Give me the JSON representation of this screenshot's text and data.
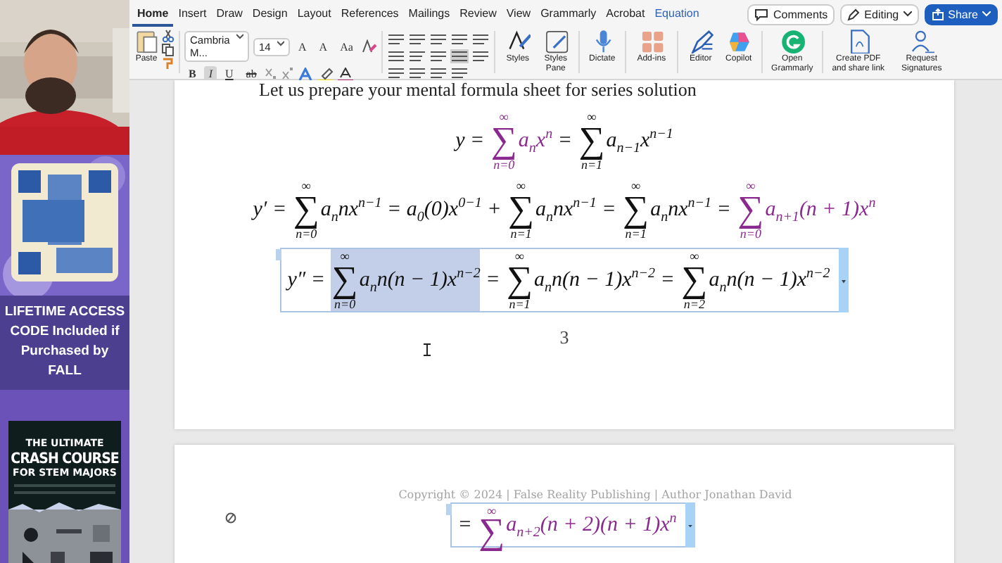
{
  "sidebar": {
    "promo_text": "LIFETIME ACCESS CODE Included if Purchased by FALL",
    "book": {
      "kicker": "THE ULTIMATE",
      "title": "CRASH COURSE",
      "subtitle": "FOR STEM MAJORS"
    }
  },
  "ribbon": {
    "tabs": [
      {
        "label": "Home",
        "selected": true,
        "contextual": false
      },
      {
        "label": "Insert",
        "selected": false,
        "contextual": false
      },
      {
        "label": "Draw",
        "selected": false,
        "contextual": false
      },
      {
        "label": "Design",
        "selected": false,
        "contextual": false
      },
      {
        "label": "Layout",
        "selected": false,
        "contextual": false
      },
      {
        "label": "References",
        "selected": false,
        "contextual": false
      },
      {
        "label": "Mailings",
        "selected": false,
        "contextual": false
      },
      {
        "label": "Review",
        "selected": false,
        "contextual": false
      },
      {
        "label": "View",
        "selected": false,
        "contextual": false
      },
      {
        "label": "Grammarly",
        "selected": false,
        "contextual": false
      },
      {
        "label": "Acrobat",
        "selected": false,
        "contextual": false
      },
      {
        "label": "Equation",
        "selected": false,
        "contextual": true
      }
    ],
    "comments": "Comments",
    "editing": "Editing",
    "share": "Share",
    "paste": "Paste",
    "font": "Cambria M...",
    "size": "14",
    "format_row1": [
      {
        "label": "A",
        "pressed": false
      },
      {
        "label": "A",
        "pressed": false
      },
      {
        "label": "Aa",
        "pressed": false
      }
    ],
    "format_row2": [
      {
        "label": "B",
        "pressed": false
      },
      {
        "label": "I",
        "pressed": true
      },
      {
        "label": "U",
        "pressed": false
      },
      {
        "label": "ab",
        "pressed": false
      }
    ],
    "tools": [
      "Styles",
      "Styles Pane",
      "Dictate",
      "Add-ins",
      "Editor",
      "Copilot",
      "Open Grammarly",
      "Create PDF and share link",
      "Request Signatures"
    ]
  },
  "document": {
    "intro": "Let us prepare your mental formula sheet for series solution",
    "equations": [
      {
        "boxed": false,
        "parts": [
          {
            "kind": "text",
            "text": "y = ",
            "emphasized": false,
            "selected": false
          },
          {
            "kind": "sum",
            "upper": "∞",
            "sign": "∑",
            "lower": "n=0",
            "emphasized": true,
            "selected": false
          },
          {
            "kind": "text",
            "text": "a$_{n}$x$^{n}$",
            "emphasized": true,
            "selected": false
          },
          {
            "kind": "text",
            "text": " = ",
            "emphasized": false,
            "selected": false
          },
          {
            "kind": "sum",
            "upper": "∞",
            "sign": "∑",
            "lower": "n=1",
            "emphasized": false,
            "selected": false
          },
          {
            "kind": "text",
            "text": "a$_{n−1}$x$^{n−1}$",
            "emphasized": false,
            "selected": false
          }
        ]
      },
      {
        "boxed": false,
        "parts": [
          {
            "kind": "text",
            "text": "y′ = ",
            "emphasized": false,
            "selected": false
          },
          {
            "kind": "sum",
            "upper": "∞",
            "sign": "∑",
            "lower": "n=0",
            "emphasized": false,
            "selected": false
          },
          {
            "kind": "text",
            "text": "a$_{n}$nx$^{n−1}$ = a$_{0}$(0)x$^{0−1}$ + ",
            "emphasized": false,
            "selected": false
          },
          {
            "kind": "sum",
            "upper": "∞",
            "sign": "∑",
            "lower": "n=1",
            "emphasized": false,
            "selected": false
          },
          {
            "kind": "text",
            "text": "a$_{n}$nx$^{n−1}$ = ",
            "emphasized": false,
            "selected": false
          },
          {
            "kind": "sum",
            "upper": "∞",
            "sign": "∑",
            "lower": "n=1",
            "emphasized": false,
            "selected": false
          },
          {
            "kind": "text",
            "text": "a$_{n}$nx$^{n−1}$ = ",
            "emphasized": false,
            "selected": false
          },
          {
            "kind": "sum",
            "upper": "∞",
            "sign": "∑",
            "lower": "n=0",
            "emphasized": true,
            "selected": false
          },
          {
            "kind": "text",
            "text": "a$_{n+1}$(n + 1)x$^{n}$",
            "emphasized": true,
            "selected": false
          }
        ]
      },
      {
        "boxed": true,
        "parts": [
          {
            "kind": "text",
            "text": "y″ = ",
            "emphasized": false,
            "selected": false
          },
          {
            "kind": "sum",
            "upper": "∞",
            "sign": "∑",
            "lower": "n=0",
            "emphasized": false,
            "selected": true
          },
          {
            "kind": "text",
            "text": "a$_{n}$n(n − 1)x$^{n−2}$",
            "emphasized": false,
            "selected": true
          },
          {
            "kind": "text",
            "text": " = ",
            "emphasized": false,
            "selected": false
          },
          {
            "kind": "sum",
            "upper": "∞",
            "sign": "∑",
            "lower": "n=1",
            "emphasized": false,
            "selected": false
          },
          {
            "kind": "text",
            "text": "a$_{n}$n(n − 1)x$^{n−2}$ = ",
            "emphasized": false,
            "selected": false
          },
          {
            "kind": "sum",
            "upper": "∞",
            "sign": "∑",
            "lower": "n=2",
            "emphasized": false,
            "selected": false
          },
          {
            "kind": "text",
            "text": "a$_{n}$n(n − 1)x$^{n−2}$",
            "emphasized": false,
            "selected": false
          }
        ]
      }
    ],
    "page_number": "3",
    "copyright": "Copyright © 2024 | False Reality Publishing | Author Jonathan David",
    "next_equation": {
      "boxed": true,
      "parts": [
        {
          "kind": "text",
          "text": "= ",
          "emphasized": false,
          "selected": false
        },
        {
          "kind": "sum",
          "upper": "∞",
          "sign": "∑",
          "emphasized": true,
          "selected": false
        },
        {
          "kind": "text",
          "text": "a$_{n+2}$(n + 2)(n + 1)x$^{n}$",
          "emphasized": true,
          "selected": false
        }
      ]
    }
  }
}
